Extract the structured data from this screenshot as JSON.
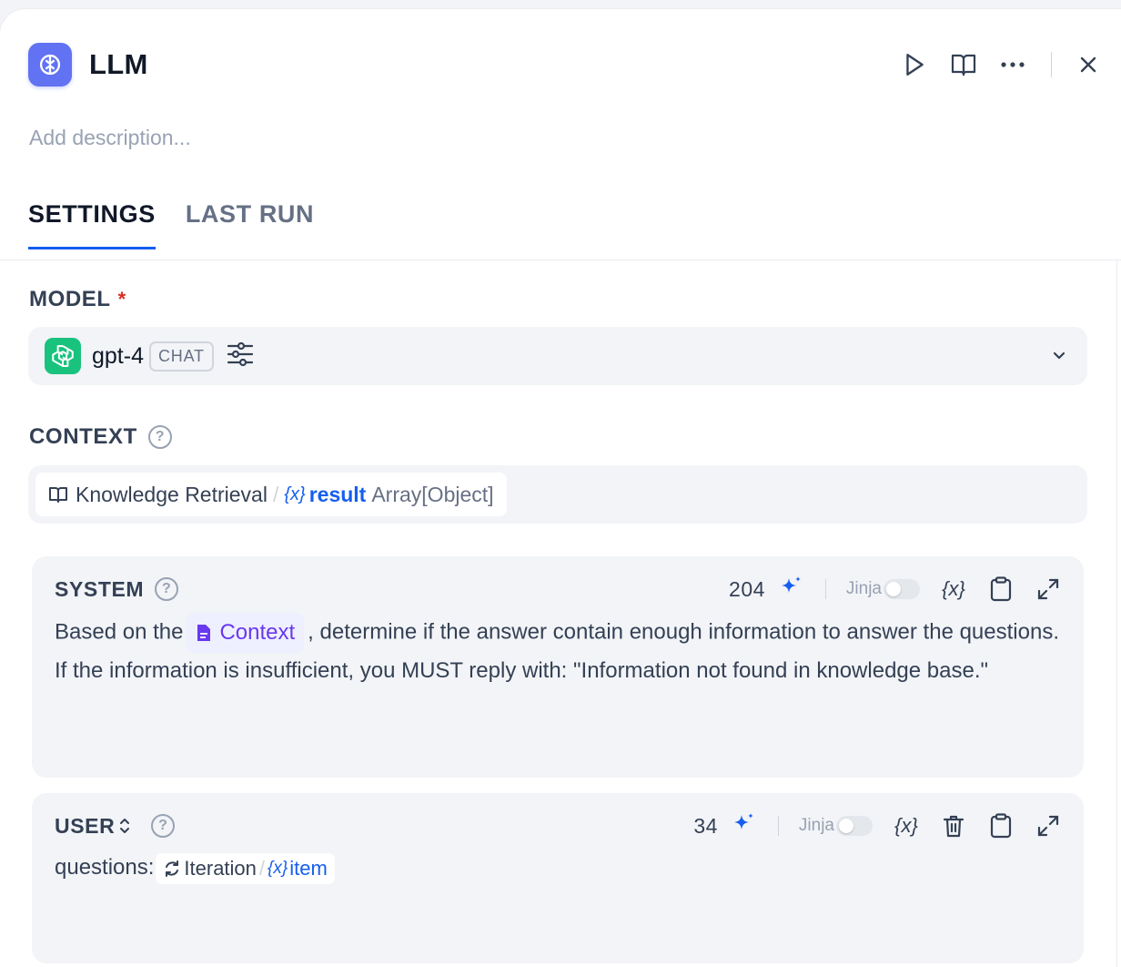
{
  "node": {
    "title": "LLM",
    "description_placeholder": "Add description..."
  },
  "tabs": [
    {
      "label": "SETTINGS",
      "active": true
    },
    {
      "label": "LAST RUN",
      "active": false
    }
  ],
  "model": {
    "label": "MODEL",
    "required_mark": "*",
    "name": "gpt-4",
    "mode_badge": "CHAT"
  },
  "context": {
    "label": "CONTEXT",
    "source_node": "Knowledge Retrieval",
    "separator": "/",
    "variable": "result",
    "variable_type": "Array[Object]"
  },
  "system_prompt": {
    "role": "SYSTEM",
    "token_count": "204",
    "jinja_label": "Jinja",
    "jinja_enabled": false,
    "text_before": "Based on the",
    "context_pill": "Context",
    "text_after": ", determine if the answer contain enough information to answer the questions.",
    "text_line2": "If the information is insufficient, you MUST reply with: \"Information not found in knowledge base.\""
  },
  "user_prompt": {
    "role": "USER",
    "token_count": "34",
    "jinja_label": "Jinja",
    "jinja_enabled": false,
    "text_before": "questions:",
    "iteration_node": "Iteration",
    "separator": "/",
    "variable": "item"
  },
  "colors": {
    "accent": "#155eef",
    "node_icon_bg": "#6172f3",
    "openai_green": "#19c37d",
    "context_purple": "#6938ef",
    "required_red": "#d92d20"
  },
  "icons": [
    "brain-icon",
    "play-icon",
    "book-open-icon",
    "more-icon",
    "close-icon",
    "openai-icon",
    "sliders-icon",
    "chevron-down-icon",
    "help-icon",
    "book-icon",
    "variable-icon",
    "sparkle-icon",
    "copy-icon",
    "expand-icon",
    "trash-icon",
    "sort-icon",
    "document-icon",
    "loop-icon"
  ]
}
